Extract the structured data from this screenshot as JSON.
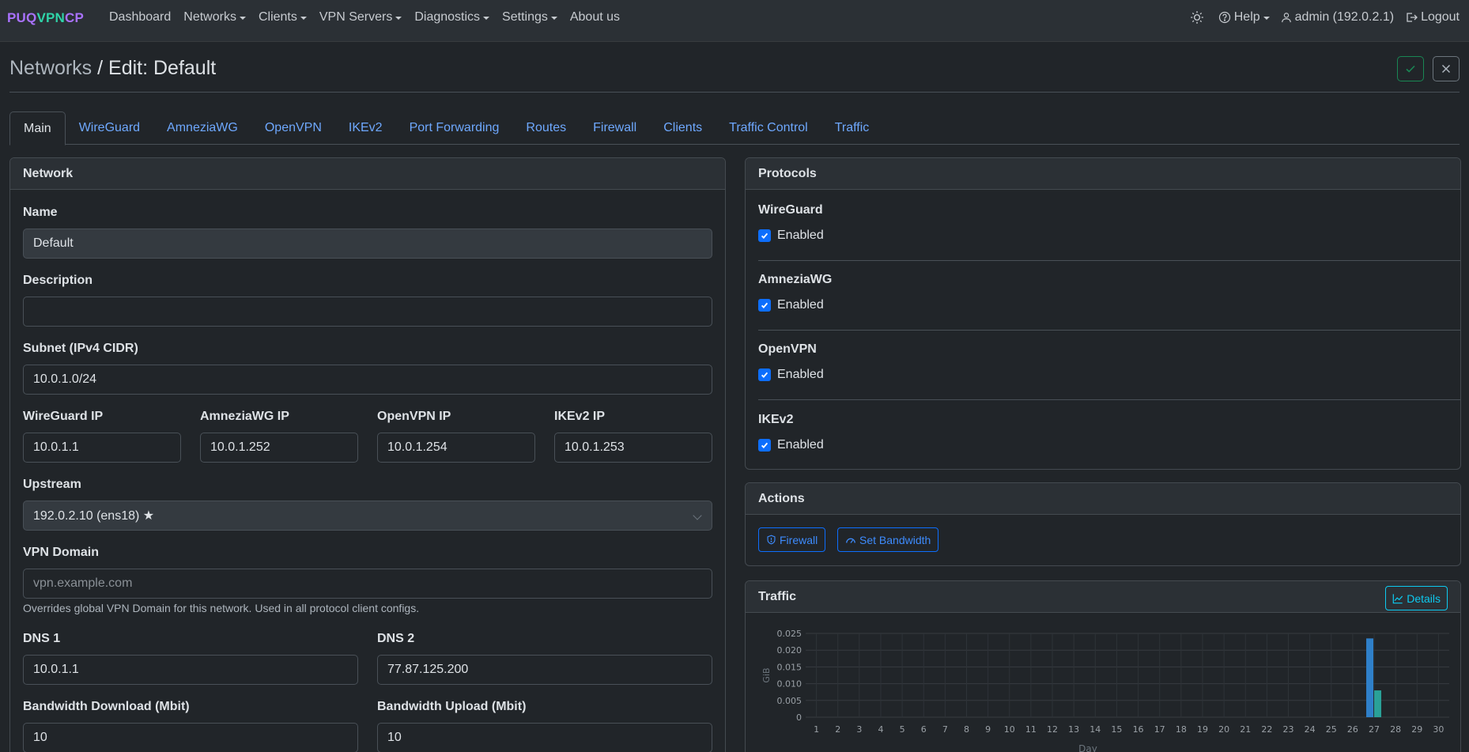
{
  "brand": {
    "part1": "PUQ",
    "part2": "VPN",
    "part3": "CP"
  },
  "nav": {
    "dashboard": "Dashboard",
    "networks": "Networks",
    "clients": "Clients",
    "vpn_servers": "VPN Servers",
    "diagnostics": "Diagnostics",
    "settings": "Settings",
    "about": "About us",
    "help": "Help",
    "user": "admin (192.0.2.1)",
    "logout": "Logout"
  },
  "header": {
    "crumb": "Networks",
    "title": "/ Edit: Default"
  },
  "tabs": [
    "Main",
    "WireGuard",
    "AmneziaWG",
    "OpenVPN",
    "IKEv2",
    "Port Forwarding",
    "Routes",
    "Firewall",
    "Clients",
    "Traffic Control",
    "Traffic"
  ],
  "network": {
    "card_title": "Network",
    "name_label": "Name",
    "name_value": "Default",
    "desc_label": "Description",
    "desc_value": "",
    "subnet_label": "Subnet (IPv4 CIDR)",
    "subnet_value": "10.0.1.0/24",
    "wg_ip_label": "WireGuard IP",
    "wg_ip_value": "10.0.1.1",
    "awg_ip_label": "AmneziaWG IP",
    "awg_ip_value": "10.0.1.252",
    "ovpn_ip_label": "OpenVPN IP",
    "ovpn_ip_value": "10.0.1.254",
    "ikev2_ip_label": "IKEv2 IP",
    "ikev2_ip_value": "10.0.1.253",
    "upstream_label": "Upstream",
    "upstream_value": "192.0.2.10 (ens18) ★",
    "domain_label": "VPN Domain",
    "domain_placeholder": "vpn.example.com",
    "domain_help": "Overrides global VPN Domain for this network. Used in all protocol client configs.",
    "dns1_label": "DNS 1",
    "dns1_value": "10.0.1.1",
    "dns2_label": "DNS 2",
    "dns2_value": "77.87.125.200",
    "bw_down_label": "Bandwidth Download (Mbit)",
    "bw_down_value": "10",
    "bw_up_label": "Bandwidth Upload (Mbit)",
    "bw_up_value": "10"
  },
  "protocols": {
    "card_title": "Protocols",
    "items": [
      {
        "name": "WireGuard",
        "state": "Enabled"
      },
      {
        "name": "AmneziaWG",
        "state": "Enabled"
      },
      {
        "name": "OpenVPN",
        "state": "Enabled"
      },
      {
        "name": "IKEv2",
        "state": "Enabled"
      }
    ]
  },
  "actions": {
    "card_title": "Actions",
    "firewall": "Firewall",
    "bandwidth": "Set Bandwidth"
  },
  "traffic": {
    "card_title": "Traffic",
    "details": "Details"
  },
  "colors": {
    "accent": "#0d6efd",
    "link": "#6ea8fe",
    "success": "#198754",
    "info": "#0dcaf0",
    "bar_download": "#2f80c9",
    "bar_upload": "#2aa198"
  },
  "chart_data": {
    "type": "bar",
    "ylabel": "GiB",
    "xlabel": "Day",
    "ylim": [
      0,
      0.025
    ],
    "yticks": [
      "0.025",
      "0.020",
      "0.015",
      "0.010",
      "0.005",
      "0"
    ],
    "categories": [
      "1",
      "2",
      "3",
      "4",
      "5",
      "6",
      "7",
      "8",
      "9",
      "10",
      "11",
      "12",
      "13",
      "14",
      "15",
      "16",
      "17",
      "18",
      "19",
      "20",
      "21",
      "22",
      "23",
      "24",
      "25",
      "26",
      "27",
      "28",
      "29",
      "30"
    ],
    "series": [
      {
        "values": [
          0,
          0,
          0,
          0,
          0,
          0,
          0,
          0,
          0,
          0,
          0,
          0,
          0,
          0,
          0,
          0,
          0,
          0,
          0,
          0,
          0,
          0,
          0,
          0,
          0,
          0,
          0.0235,
          0,
          0,
          0
        ]
      },
      {
        "values": [
          0,
          0,
          0,
          0,
          0,
          0,
          0,
          0,
          0,
          0,
          0,
          0,
          0,
          0,
          0,
          0,
          0,
          0,
          0,
          0,
          0,
          0,
          0,
          0,
          0,
          0,
          0.008,
          0,
          0,
          0
        ]
      }
    ],
    "grid": true
  }
}
